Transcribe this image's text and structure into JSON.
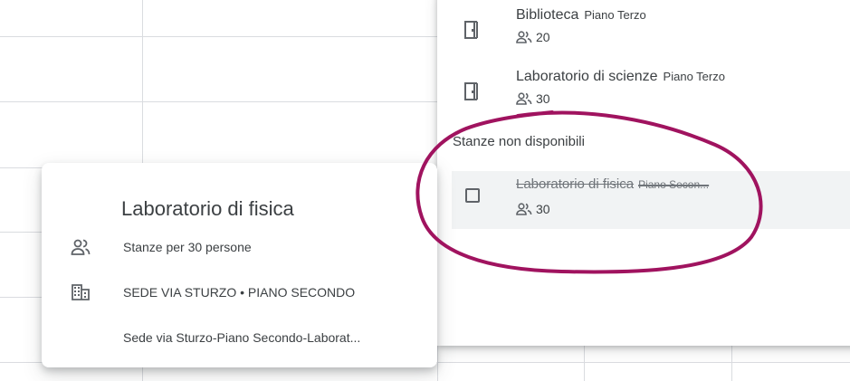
{
  "rooms_panel": {
    "available_rooms": [
      {
        "name": "Biblioteca",
        "floor": "Piano Terzo",
        "capacity": "20"
      },
      {
        "name": "Laboratorio di scienze",
        "floor": "Piano Terzo",
        "capacity": "30"
      }
    ],
    "unavailable_section_label": "Stanze non disponibili",
    "unavailable_rooms": [
      {
        "name": "Laboratorio di fisica",
        "floor": "Piano Secon...",
        "capacity": "30"
      }
    ]
  },
  "room_popup": {
    "title": "Laboratorio di fisica",
    "capacity_text": "Stanze per 30 persone",
    "building_text": "SEDE VIA STURZO • PIANO SECONDO",
    "resource_text": "Sede via Sturzo-Piano Secondo-Laborat..."
  },
  "annotation_color": "#a0135f",
  "icons": [
    "door-icon",
    "people-icon",
    "building-icon",
    "checkbox"
  ]
}
